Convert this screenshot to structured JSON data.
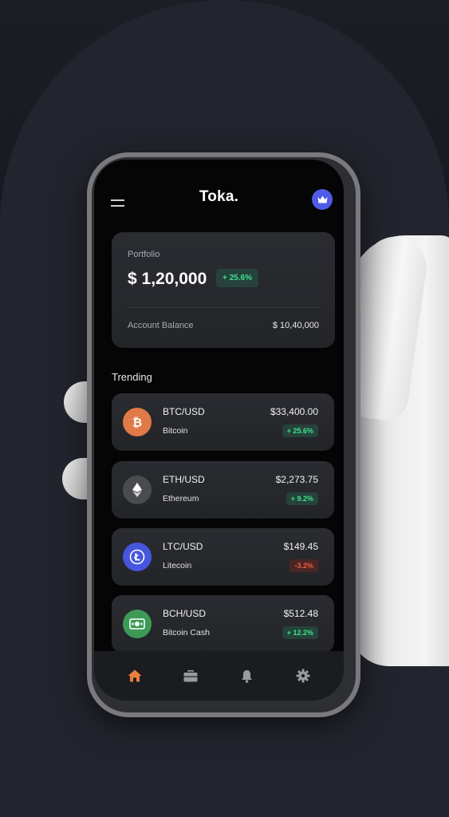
{
  "app": {
    "title": "Toka."
  },
  "portfolio": {
    "label": "Portfolio",
    "amount": "$ 1,20,000",
    "change": "+ 25.6%",
    "account_balance_label": "Account Balance",
    "account_balance_value": "$ 10,40,000"
  },
  "trending": {
    "title": "Trending",
    "items": [
      {
        "pair": "BTC/USD",
        "name": "Bitcoin",
        "price": "$33,400.00",
        "change": "+ 25.6%",
        "direction": "up",
        "icon": "bitcoin-icon",
        "color": "#e07a46"
      },
      {
        "pair": "ETH/USD",
        "name": "Ethereum",
        "price": "$2,273.75",
        "change": "+ 9.2%",
        "direction": "up",
        "icon": "ethereum-icon",
        "color": "#4a4b4f"
      },
      {
        "pair": "LTC/USD",
        "name": "Litecoin",
        "price": "$149.45",
        "change": "-3.2%",
        "direction": "down",
        "icon": "litecoin-icon",
        "color": "#4656df"
      },
      {
        "pair": "BCH/USD",
        "name": "Bitcoin Cash",
        "price": "$512.48",
        "change": "+ 12.2%",
        "direction": "up",
        "icon": "bitcoin-cash-icon",
        "color": "#3d9a56"
      }
    ]
  },
  "nav": {
    "items": [
      {
        "icon": "home-icon",
        "active": true
      },
      {
        "icon": "briefcase-icon",
        "active": false
      },
      {
        "icon": "bell-icon",
        "active": false
      },
      {
        "icon": "gear-icon",
        "active": false
      }
    ]
  },
  "colors": {
    "accent": "#e97e3d",
    "positive": "#3ee28f",
    "negative": "#ef5a45",
    "avatar": "#4f5be7"
  }
}
